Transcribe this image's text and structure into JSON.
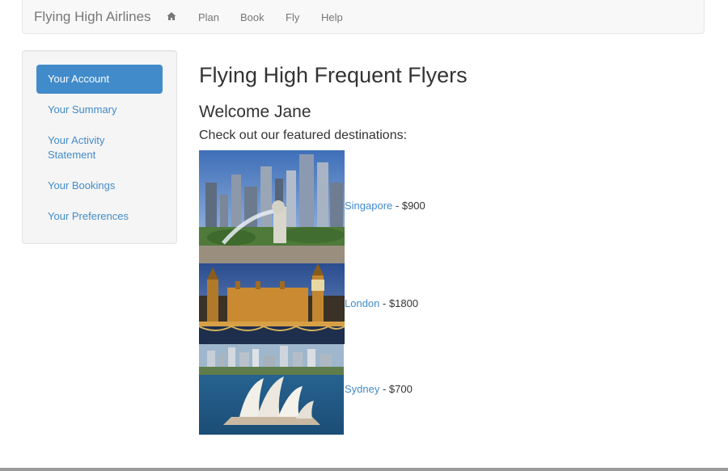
{
  "navbar": {
    "brand": "Flying High Airlines",
    "home_icon": "home-icon",
    "items": [
      {
        "label": "Plan"
      },
      {
        "label": "Book"
      },
      {
        "label": "Fly"
      },
      {
        "label": "Help"
      }
    ]
  },
  "sidebar": {
    "items": [
      {
        "label": "Your Account",
        "active": true
      },
      {
        "label": "Your Summary"
      },
      {
        "label": "Your Activity Statement"
      },
      {
        "label": "Your Bookings"
      },
      {
        "label": "Your Preferences"
      }
    ]
  },
  "main": {
    "title": "Flying High Frequent Flyers",
    "welcome": "Welcome Jane",
    "featured_heading": "Check out our featured destinations:",
    "destinations": [
      {
        "name": "Singapore",
        "price": " - $900"
      },
      {
        "name": "London",
        "price": " - $1800"
      },
      {
        "name": "Sydney",
        "price": " - $700"
      }
    ]
  },
  "colors": {
    "accent": "#428bca",
    "navbar_bg": "#f8f8f8",
    "sidebar_bg": "#f5f5f5"
  }
}
